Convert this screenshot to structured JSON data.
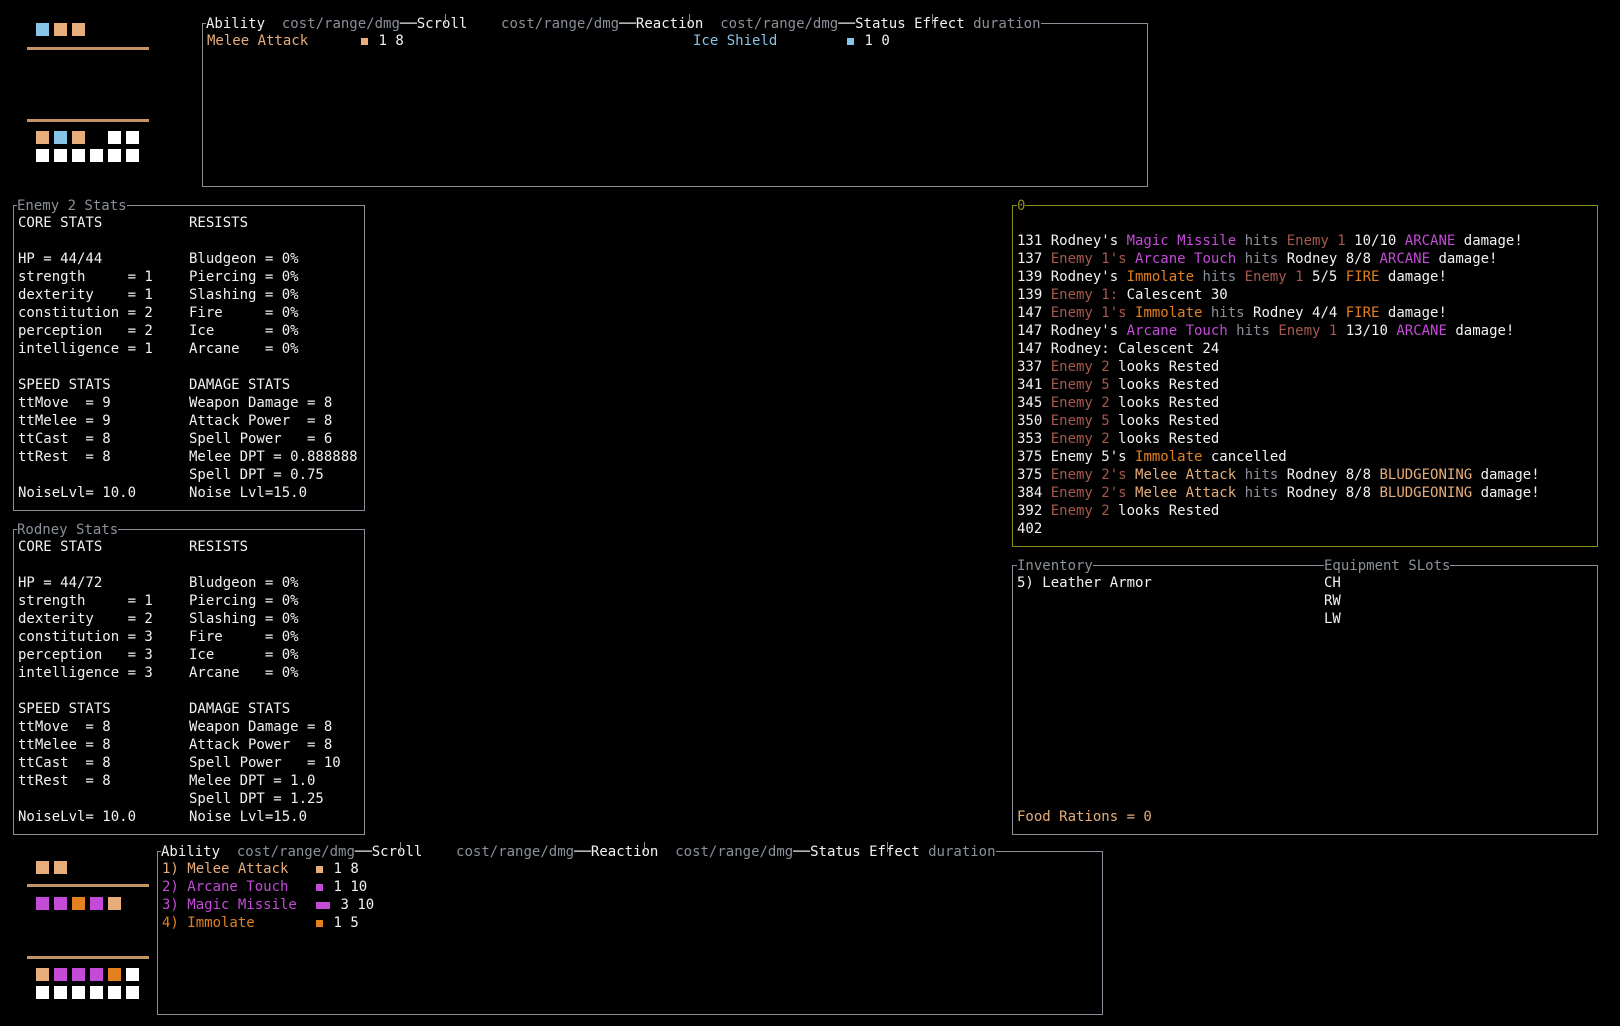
{
  "colors": {
    "physical": "#e7ad7a",
    "arcane": "#c44ad8",
    "fire": "#e3801f",
    "enemy": "#a7584d",
    "ice": "#87c4e8",
    "white": "#ffffff"
  },
  "enemy_bar": {
    "top_squares": [
      "#87c4e8",
      "#e7ad7a",
      "#e7ad7a"
    ],
    "row1": [
      "#e7ad7a",
      "#87c4e8",
      "#e7ad7a",
      "",
      "#ffffff",
      "#ffffff"
    ],
    "row2": [
      "#ffffff",
      "#ffffff",
      "#ffffff",
      "#ffffff",
      "#ffffff",
      "#ffffff"
    ]
  },
  "player_bar": {
    "top_squares": [
      "#e7ad7a",
      "#e7ad7a"
    ],
    "middle": [
      "#c44ad8",
      "#c44ad8",
      "#e3801f",
      "#c44ad8",
      "#e7ad7a"
    ],
    "row1": [
      "#e7ad7a",
      "#c44ad8",
      "#c44ad8",
      "#c44ad8",
      "#e3801f",
      "#ffffff"
    ],
    "row2": [
      "#ffffff",
      "#ffffff",
      "#ffffff",
      "#ffffff",
      "#ffffff",
      "#ffffff"
    ]
  },
  "ability_header": {
    "ability": "Ability",
    "cost1": "cost/range/dmg",
    "scroll": "Scroll",
    "cost2": "cost/range/dmg",
    "reaction": "Reaction",
    "cost3": "cost/range/dmg",
    "status": "Status Effect",
    "duration": "duration"
  },
  "enemy_abilities": {
    "items": [
      {
        "name": "Melee Attack",
        "cost": "1",
        "range": "8"
      }
    ],
    "reactions": [
      {
        "name": "Ice Shield",
        "cost": "1",
        "range": "0"
      }
    ]
  },
  "player_abilities": {
    "items": [
      {
        "name": "1) Melee Attack",
        "cost": "1",
        "range": "8"
      },
      {
        "name": "2) Arcane Touch",
        "cost": "1",
        "range": "10"
      },
      {
        "name": "3) Magic Missile",
        "cost": "3",
        "range": "10"
      },
      {
        "name": "4) Immolate",
        "cost": "1",
        "range": "5"
      }
    ]
  },
  "enemy_stats": {
    "title": "Enemy 2 Stats",
    "core_label": "CORE STATS",
    "resists_label": "RESISTS",
    "hp": "HP = 44/44",
    "core": [
      "strength     = 1",
      "dexterity    = 1",
      "constitution = 2",
      "perception   = 2",
      "intelligence = 1"
    ],
    "resists": [
      "Bludgeon = 0%",
      "Piercing = 0%",
      "Slashing = 0%",
      "Fire     = 0%",
      "Ice      = 0%",
      "Arcane   = 0%"
    ],
    "speed_label": "SPEED STATS",
    "damage_label": "DAMAGE STATS",
    "speed": [
      "ttMove  = 9",
      "ttMelee = 9",
      "ttCast  = 8",
      "ttRest  = 8"
    ],
    "damage": [
      "Weapon Damage = 8",
      "Attack Power  = 8",
      "Spell Power   = 6",
      "Melee DPT = 0.888888",
      "Spell DPT = 0.75"
    ],
    "noise_lvl": "NoiseLvl= 10.0",
    "noise_lvl2": "Noise Lvl=15.0"
  },
  "player_stats": {
    "title": "Rodney Stats",
    "core_label": "CORE STATS",
    "resists_label": "RESISTS",
    "hp": "HP = 44/72",
    "core": [
      "strength     = 1",
      "dexterity    = 2",
      "constitution = 3",
      "perception   = 3",
      "intelligence = 3"
    ],
    "resists": [
      "Bludgeon = 0%",
      "Piercing = 0%",
      "Slashing = 0%",
      "Fire     = 0%",
      "Ice      = 0%",
      "Arcane   = 0%"
    ],
    "speed_label": "SPEED STATS",
    "damage_label": "DAMAGE STATS",
    "speed": [
      "ttMove  = 8",
      "ttMelee = 8",
      "ttCast  = 8",
      "ttRest  = 8"
    ],
    "damage": [
      "Weapon Damage = 8",
      "Attack Power  = 8",
      "Spell Power   = 10",
      "Melee DPT = 1.0",
      "Spell DPT = 1.25"
    ],
    "noise_lvl": "NoiseLvl= 10.0",
    "noise_lvl2": "Noise Lvl=15.0"
  },
  "log": {
    "title": "0",
    "lines": [
      [
        [
          "w",
          "131 Rodney's "
        ],
        [
          "pur",
          "Magic Missile"
        ],
        [
          "g",
          " hits "
        ],
        [
          "brn",
          "Enemy 1"
        ],
        [
          "w",
          " 10/10 "
        ],
        [
          "pur",
          "ARCANE"
        ],
        [
          "w",
          " damage!"
        ]
      ],
      [
        [
          "w",
          "137 "
        ],
        [
          "brn",
          "Enemy 1's "
        ],
        [
          "pur",
          "Arcane Touch"
        ],
        [
          "g",
          " hits "
        ],
        [
          "w",
          "Rodney 8/8 "
        ],
        [
          "pur",
          "ARCANE"
        ],
        [
          "w",
          " damage!"
        ]
      ],
      [
        [
          "w",
          "139 Rodney's "
        ],
        [
          "org",
          "Immolate"
        ],
        [
          "g",
          " hits "
        ],
        [
          "brn",
          "Enemy 1"
        ],
        [
          "w",
          " 5/5 "
        ],
        [
          "org",
          "FIRE"
        ],
        [
          "w",
          " damage!"
        ]
      ],
      [
        [
          "w",
          "139 "
        ],
        [
          "brn",
          "Enemy 1:"
        ],
        [
          "w",
          " Calescent 30"
        ]
      ],
      [
        [
          "w",
          "147 "
        ],
        [
          "brn",
          "Enemy 1's "
        ],
        [
          "org",
          "Immolate"
        ],
        [
          "g",
          " hits "
        ],
        [
          "w",
          "Rodney 4/4 "
        ],
        [
          "org",
          "FIRE"
        ],
        [
          "w",
          " damage!"
        ]
      ],
      [
        [
          "w",
          "147 Rodney's "
        ],
        [
          "pur",
          "Arcane Touch"
        ],
        [
          "g",
          " hits "
        ],
        [
          "brn",
          "Enemy 1"
        ],
        [
          "w",
          " 13/10 "
        ],
        [
          "pur",
          "ARCANE"
        ],
        [
          "w",
          " damage!"
        ]
      ],
      [
        [
          "w",
          "147 Rodney: Calescent 24"
        ]
      ],
      [
        [
          "w",
          "337 "
        ],
        [
          "brn",
          "Enemy 2"
        ],
        [
          "w",
          " looks Rested"
        ]
      ],
      [
        [
          "w",
          "341 "
        ],
        [
          "brn",
          "Enemy 5"
        ],
        [
          "w",
          " looks Rested"
        ]
      ],
      [
        [
          "w",
          "345 "
        ],
        [
          "brn",
          "Enemy 2"
        ],
        [
          "w",
          " looks Rested"
        ]
      ],
      [
        [
          "w",
          "350 "
        ],
        [
          "brn",
          "Enemy 5"
        ],
        [
          "w",
          " looks Rested"
        ]
      ],
      [
        [
          "w",
          "353 "
        ],
        [
          "brn",
          "Enemy 2"
        ],
        [
          "w",
          " looks Rested"
        ]
      ],
      [
        [
          "w",
          "375 Enemy 5's "
        ],
        [
          "org",
          "Immolate"
        ],
        [
          "w",
          " cancelled"
        ]
      ],
      [
        [
          "w",
          "375 "
        ],
        [
          "brn",
          "Enemy 2's "
        ],
        [
          "tan",
          "Melee Attack"
        ],
        [
          "g",
          " hits "
        ],
        [
          "w",
          "Rodney 8/8 "
        ],
        [
          "tan",
          "BLUDGEONING"
        ],
        [
          "w",
          " damage!"
        ]
      ],
      [
        [
          "w",
          "384 "
        ],
        [
          "brn",
          "Enemy 2's "
        ],
        [
          "tan",
          "Melee Attack"
        ],
        [
          "g",
          " hits "
        ],
        [
          "w",
          "Rodney 8/8 "
        ],
        [
          "tan",
          "BLUDGEONING"
        ],
        [
          "w",
          " damage!"
        ]
      ],
      [
        [
          "w",
          "392 "
        ],
        [
          "brn",
          "Enemy 2"
        ],
        [
          "w",
          " looks Rested"
        ]
      ],
      [
        [
          "w",
          "402"
        ]
      ]
    ]
  },
  "inventory": {
    "title": "Inventory",
    "equip_title": "Equipment SLots",
    "items": [
      "5) Leather Armor"
    ],
    "slots": [
      "CH",
      "RW",
      "LW"
    ],
    "food": "Food Rations = 0"
  }
}
